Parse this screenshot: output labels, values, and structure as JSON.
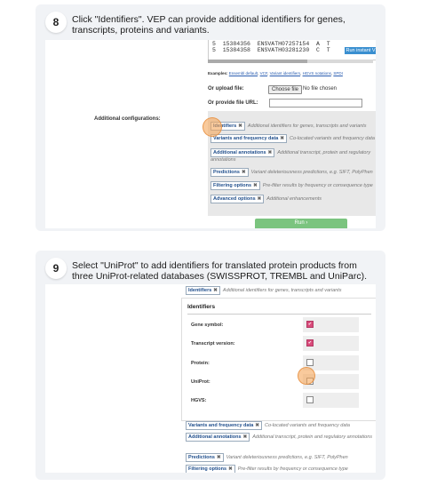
{
  "step8": {
    "number": "8",
    "instruction": "Click \"Identifiers\". VEP can provide additional identifiers for genes, transcripts, proteins and variants.",
    "textarea_lines": [
      "5  15384356  ENSVATH07257154  A  T",
      "5  15384358  ENSVATH03281230  C  T"
    ],
    "run_instant": "Run instant V",
    "examples_label": "Examples:",
    "examples_links": [
      "Ensembl default",
      "VCF",
      "Variant identifiers",
      "HGVS notations",
      "SPDI"
    ],
    "upload_label": "Or upload file:",
    "choose_file": "Choose file",
    "no_file": "No file chosen",
    "url_label": "Or provide file URL:",
    "additional_config": "Additional configurations:",
    "options": [
      {
        "tag": "Identifiers",
        "desc": "Additional identifiers for genes, transcripts and variants"
      },
      {
        "tag": "Variants and frequency data",
        "desc": "Co-located variants and frequency data"
      },
      {
        "tag": "Additional annotations",
        "desc": "Additional transcript, protein and regulatory annotations"
      },
      {
        "tag": "Predictions",
        "desc": "Variant deleteriousness predictions, e.g. SIFT, PolyPhen"
      },
      {
        "tag": "Filtering options",
        "desc": "Pre-filter results by frequency or consequence type"
      },
      {
        "tag": "Advanced options",
        "desc": "Additional enhancements"
      }
    ],
    "run_button": "Run ›"
  },
  "step9": {
    "number": "9",
    "instruction": "Select \"UniProt\" to add identifiers for translated protein products from three UniProt-related databases (SWISSPROT, TREMBL and UniParc).",
    "top_tag": "Identifiers",
    "top_desc": "Additional identifiers for genes, transcripts and variants",
    "panel_title": "Identifiers",
    "fields": [
      {
        "label": "Gene symbol:",
        "checked": true
      },
      {
        "label": "Transcript version:",
        "checked": true
      },
      {
        "label": "Protein:",
        "checked": false
      },
      {
        "label": "UniProt:",
        "checked": false
      },
      {
        "label": "HGVS:",
        "checked": false
      }
    ],
    "options": [
      {
        "tag": "Variants and frequency data",
        "desc": "Co-located variants and frequency data"
      },
      {
        "tag": "Additional annotations",
        "desc": "Additional transcript, protein and regulatory annotations"
      },
      {
        "tag": "Predictions",
        "desc": "Variant deleteriousness predictions, e.g. SIFT, PolyPhen"
      },
      {
        "tag": "Filtering options",
        "desc": "Pre-filter results by frequency or consequence type"
      }
    ],
    "close_glyph": "✖",
    "check_glyph": "✔"
  }
}
